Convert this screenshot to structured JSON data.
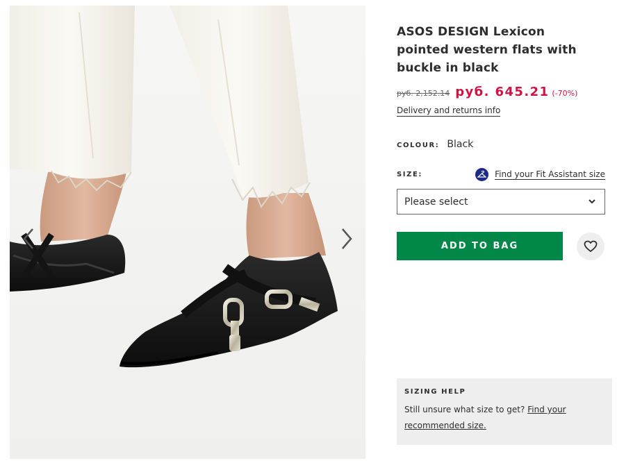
{
  "gallery": {
    "image_alt": "Black pointed western flats with silver buckles",
    "prev_icon": "chevron-left-icon",
    "next_icon": "chevron-right-icon"
  },
  "product": {
    "title": "ASOS DESIGN Lexicon pointed western flats with buckle in black",
    "price_old": "руб. 2,152.14",
    "price_now": "руб. 645.21",
    "discount": "(-70%)",
    "delivery_link": "Delivery and returns info",
    "colour_label": "COLOUR:",
    "colour_value": "Black",
    "size_label": "SIZE:",
    "fit_assistant_link": "Find your Fit Assistant size",
    "size_placeholder": "Please select",
    "add_to_bag": "ADD TO BAG",
    "save_icon": "heart-icon"
  },
  "sizing_help": {
    "heading": "SIZING HELP",
    "text": "Still unsure what size to get?",
    "link": "Find your recommended size."
  },
  "colors": {
    "accent_price": "#d01345",
    "add_button": "#018849",
    "fit_icon_bg": "#1d2a8a",
    "panel_bg": "#eeeeee"
  }
}
